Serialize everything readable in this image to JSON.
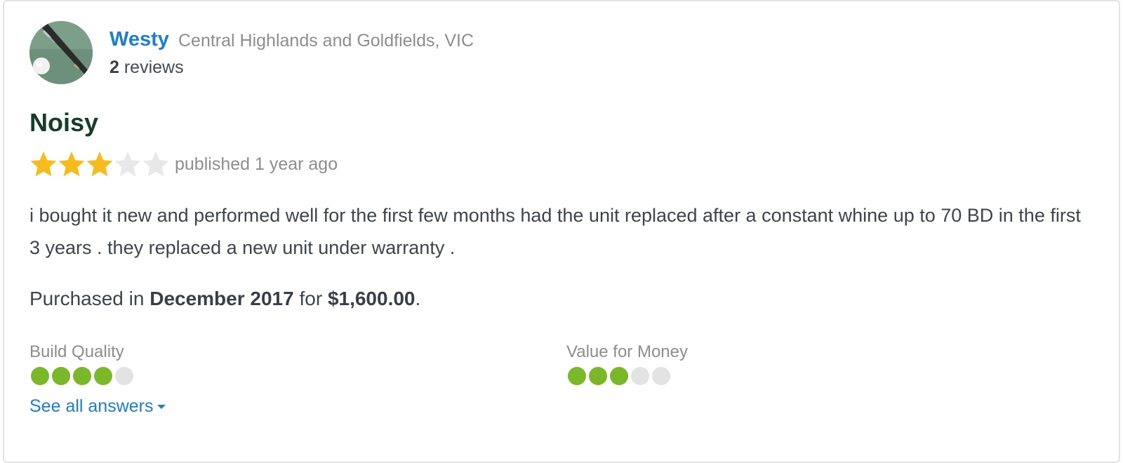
{
  "reviewer": {
    "name": "Westy",
    "location": "Central Highlands and Goldfields, VIC",
    "review_count": "2",
    "review_count_suffix": " reviews"
  },
  "review": {
    "title": "Noisy",
    "rating": 3,
    "rating_max": 5,
    "published": "published 1 year ago",
    "body": "i bought it new and performed well for the first few months had the unit replaced after a constant whine up to 70 BD in the first 3 years . they replaced a new unit under warranty .",
    "purchase": {
      "prefix": "Purchased in ",
      "date": "December 2017",
      "middle": " for ",
      "price": "$1,600.00",
      "suffix": "."
    }
  },
  "ratings": [
    {
      "label": "Build Quality",
      "score": 4,
      "max": 5
    },
    {
      "label": "Value for Money",
      "score": 3,
      "max": 5
    }
  ],
  "see_all_label": "See all answers",
  "colors": {
    "link": "#1a7fd1",
    "title": "#163d2a",
    "star_on": "#f7bc1c",
    "star_off": "#e8e8e8",
    "dot_on": "#7ab829",
    "dot_off": "#e3e3e3",
    "muted": "#8d8d8d"
  },
  "icons": {
    "avatar": "hockey-stick-avatar",
    "star": "star-icon",
    "caret": "caret-down-icon"
  }
}
